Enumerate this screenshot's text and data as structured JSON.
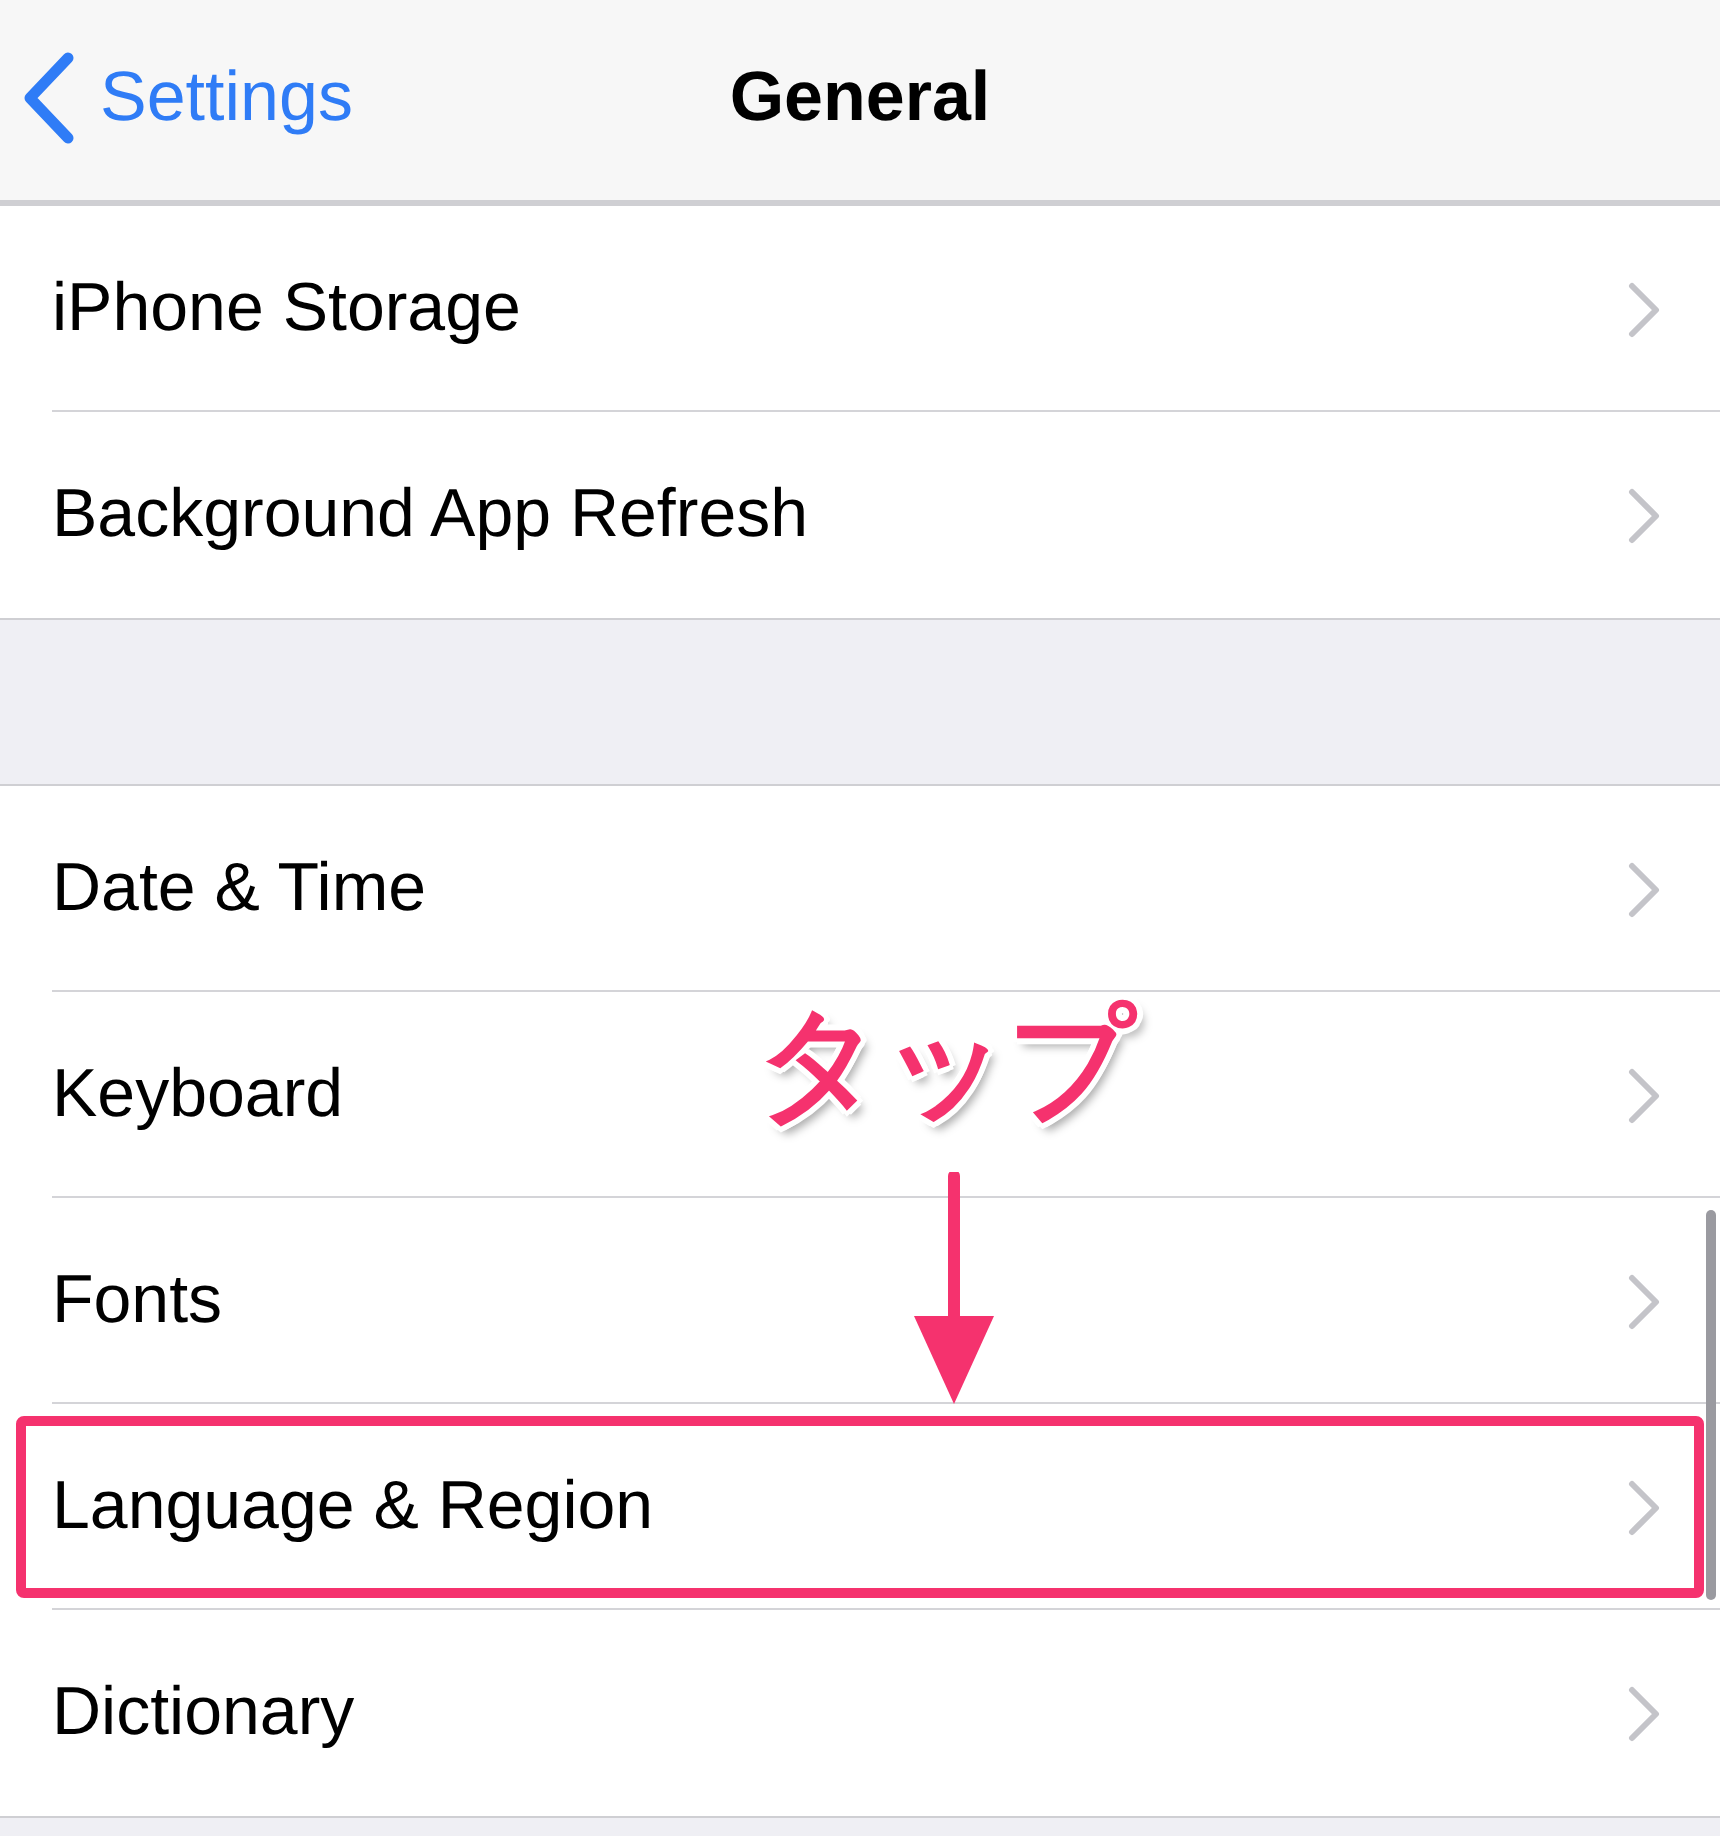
{
  "nav": {
    "back_label": "Settings",
    "title": "General"
  },
  "groups": [
    {
      "rows": [
        {
          "label": "iPhone Storage",
          "highlighted": false
        },
        {
          "label": "Background App Refresh",
          "highlighted": false
        }
      ]
    },
    {
      "rows": [
        {
          "label": "Date & Time",
          "highlighted": false
        },
        {
          "label": "Keyboard",
          "highlighted": false
        },
        {
          "label": "Fonts",
          "highlighted": false
        },
        {
          "label": "Language & Region",
          "highlighted": true
        },
        {
          "label": "Dictionary",
          "highlighted": false
        }
      ]
    }
  ],
  "annotation": {
    "label": "タップ"
  }
}
